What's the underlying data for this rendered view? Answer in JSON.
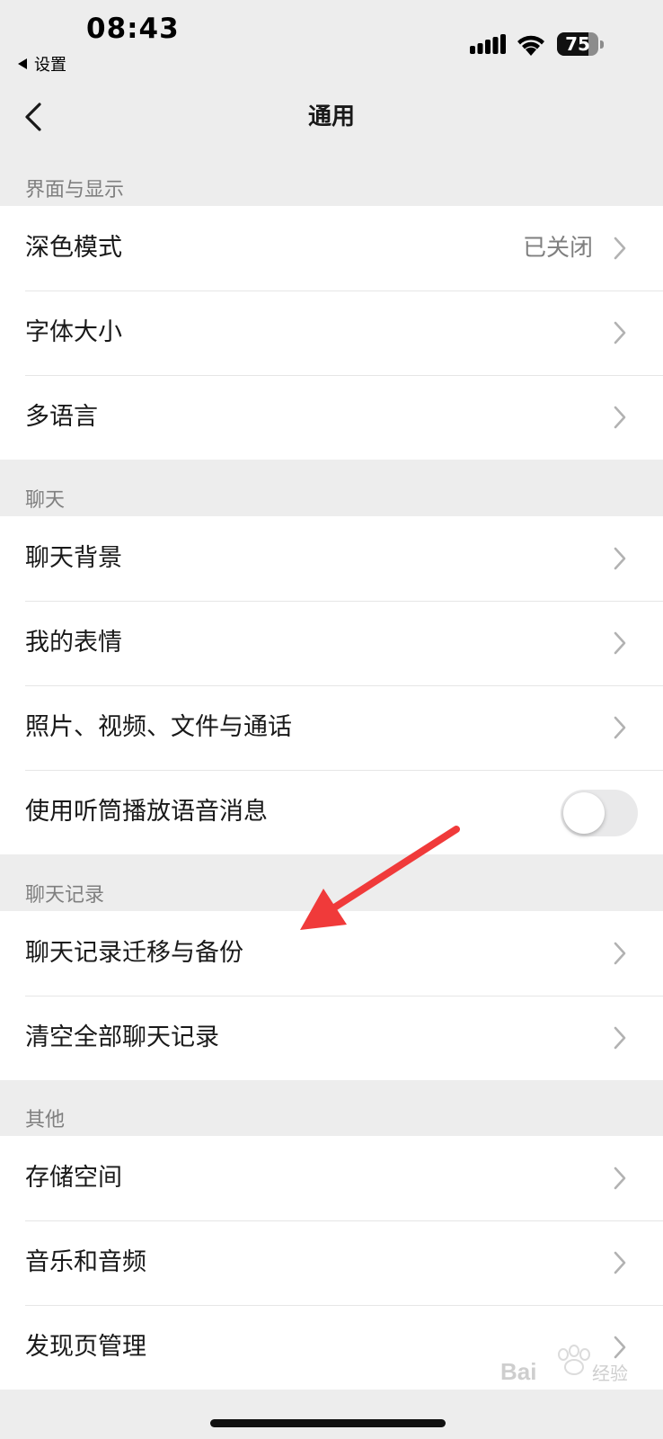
{
  "status_bar": {
    "time": "08:43",
    "back_app": "设置",
    "battery_percent": "75",
    "battery_level": 0.75
  },
  "nav": {
    "title": "通用"
  },
  "sections": [
    {
      "header": "界面与显示",
      "items": [
        {
          "label": "深色模式",
          "value": "已关闭"
        },
        {
          "label": "字体大小"
        },
        {
          "label": "多语言"
        }
      ]
    },
    {
      "header": "聊天",
      "items": [
        {
          "label": "聊天背景"
        },
        {
          "label": "我的表情"
        },
        {
          "label": "照片、视频、文件与通话"
        },
        {
          "label": "使用听筒播放语音消息",
          "toggle": false
        }
      ]
    },
    {
      "header": "聊天记录",
      "items": [
        {
          "label": "聊天记录迁移与备份"
        },
        {
          "label": "清空全部聊天记录"
        }
      ]
    },
    {
      "header": "其他",
      "items": [
        {
          "label": "存储空间"
        },
        {
          "label": "音乐和音频"
        },
        {
          "label": "发现页管理"
        }
      ]
    }
  ],
  "watermark": "Baidu经验",
  "colors": {
    "background": "#ededed",
    "card": "#ffffff",
    "secondary_text": "#7f7f7f",
    "annotation_arrow": "#f03a3a"
  }
}
